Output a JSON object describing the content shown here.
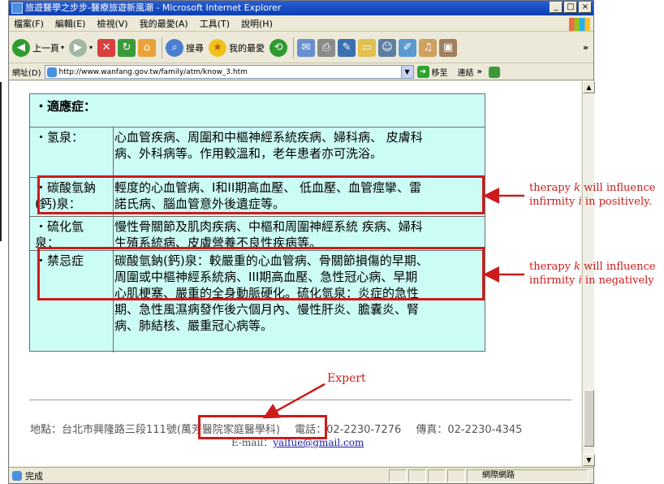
{
  "window": {
    "title": "旅遊醫學之步步-醫療旅遊新風潮 - Microsoft Internet Explorer",
    "controls": [
      "_",
      "□",
      "×"
    ]
  },
  "menu": [
    "檔案(F)",
    "編輯(E)",
    "檢視(V)",
    "我的最愛(A)",
    "工具(T)",
    "說明(H)"
  ],
  "toolbar": {
    "back": "上一頁",
    "search": "搜尋",
    "favorites": "我的最愛",
    "overflow": "»"
  },
  "address": {
    "label": "網址(D)",
    "url": "http://www.wanfang.gov.tw/family/atm/know_3.htm",
    "go": "移至",
    "links": "連結",
    "overflow": "»"
  },
  "content": {
    "header": "・適應症：",
    "rows": [
      {
        "label": "・氢泉：",
        "text": "心血管疾病、周圍和中樞神經系統疾病、婦科病、 皮膚科\n病、外科病等。作用較溫和，老年患者亦可洗浴。"
      },
      {
        "label": "・碳酸氫鈉\n  (鈣)泉：",
        "text": "輕度的心血管病、I和II期高血壓、 低血壓、血管痙攣、雷\n諾氏病、腦血管意外後遺症等。"
      },
      {
        "label": "・硫化氫\n泉：",
        "text": "慢性骨關節及肌肉疾病、中樞和周圍神經系統 疾病、婦科\n生殖系統病、皮膚營養不良性疾病等。"
      },
      {
        "label": "・禁忌症",
        "text": "碳酸氫鈉(鈣)泉：較嚴重的心血管病、骨關節損傷的早期、\n周圍或中樞神經系統病、III期高血壓、急性冠心病、早期\n心肌梗塞、嚴重的全身動脈硬化。硫化氫泉：炎症的急性\n期、急性風濕病發作後六個月內、慢性肝炎、膽囊炎、腎\n病、肺結核、嚴重冠心病等。"
      }
    ]
  },
  "annotations": {
    "positive": [
      "therapy ",
      "k",
      " will influence",
      "infirmity ",
      "i",
      " in positively."
    ],
    "negative": [
      "therapy ",
      "k",
      " will influence",
      "infirmity ",
      "i",
      " in negatively"
    ],
    "expert": "Expert",
    "color": "#cc1b1b"
  },
  "footer": {
    "location_prefix": "地點：台北市興隆路三段111號",
    "dept": "(萬芳醫院家庭醫學科)",
    "phone": "電話：02-2230-7276",
    "fax": "傳真：02-2230-4345",
    "email_label": "E-mail：",
    "email": "yalfue@gmail.com"
  },
  "status": {
    "text": "完成",
    "zone": "網際網路"
  }
}
